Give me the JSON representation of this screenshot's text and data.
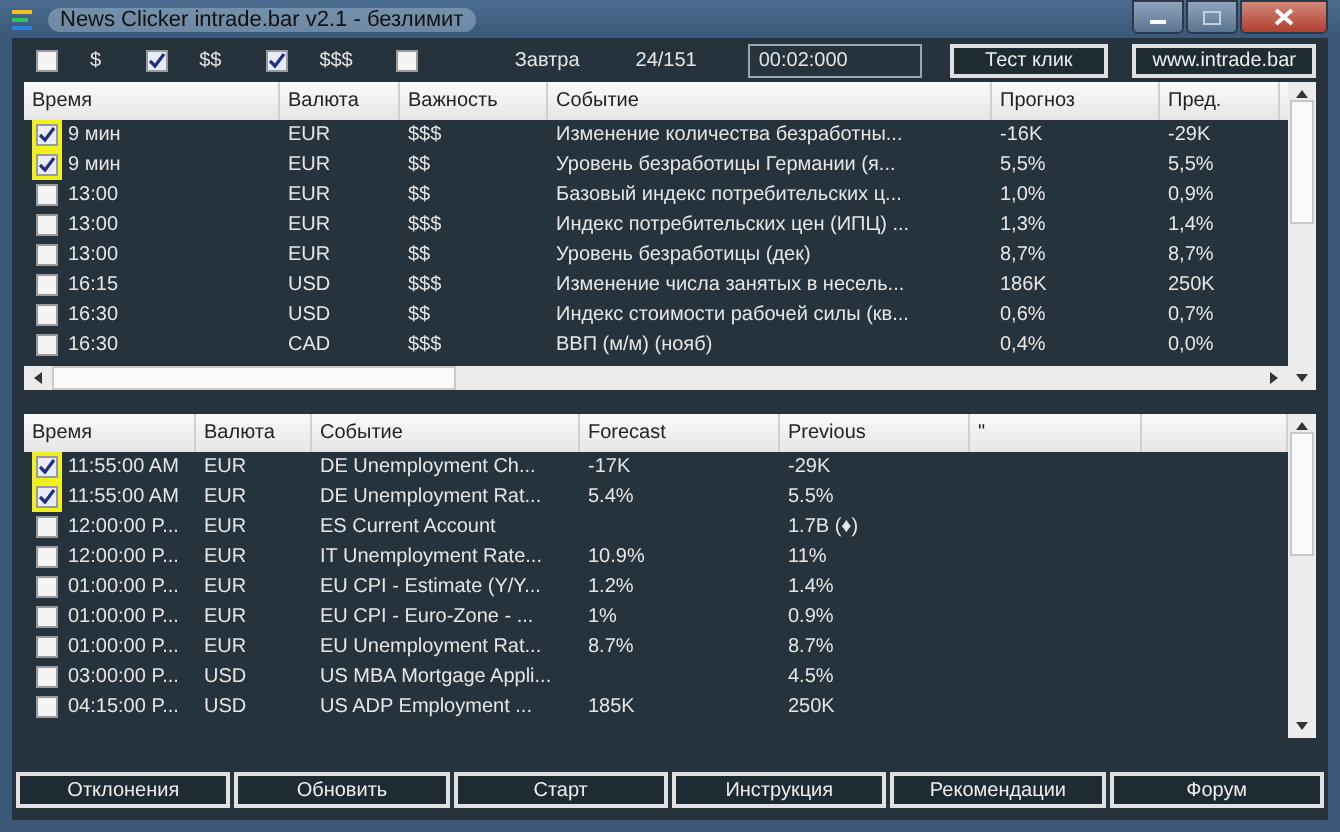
{
  "window": {
    "title": "News Clicker intrade.bar v2.1  - безлимит"
  },
  "toolbar": {
    "filters": [
      {
        "kind": "checkbox",
        "checked": false
      },
      {
        "kind": "label",
        "text": "$"
      },
      {
        "kind": "checkbox",
        "checked": true
      },
      {
        "kind": "label",
        "text": "$$"
      },
      {
        "kind": "checkbox",
        "checked": true
      },
      {
        "kind": "label",
        "text": "$$$"
      },
      {
        "kind": "checkbox",
        "checked": false
      }
    ],
    "tomorrow": "Завтра",
    "count": "24/151",
    "timer": "00:02:000",
    "buttons": [
      "Тест клик",
      "www.intrade.bar"
    ]
  },
  "top_table": {
    "columns": [
      "Время",
      "Валюта",
      "Важность",
      "Событие",
      "Прогноз",
      "Пред."
    ],
    "rows": [
      {
        "checked": true,
        "highlighted": true,
        "cells": [
          "9 мин",
          "EUR",
          "$$$",
          "Изменение количества безработны...",
          "-16K",
          "-29K"
        ]
      },
      {
        "checked": true,
        "highlighted": true,
        "cells": [
          "9 мин",
          "EUR",
          "$$",
          "Уровень безработицы Германии  (я...",
          "5,5%",
          "5,5%"
        ]
      },
      {
        "checked": false,
        "highlighted": false,
        "cells": [
          "13:00",
          "EUR",
          "$$",
          "Базовый индекс потребительских ц...",
          "1,0%",
          "0,9%"
        ]
      },
      {
        "checked": false,
        "highlighted": false,
        "cells": [
          "13:00",
          "EUR",
          "$$$",
          "Индекс потребительских цен (ИПЦ) ...",
          "1,3%",
          "1,4%"
        ]
      },
      {
        "checked": false,
        "highlighted": false,
        "cells": [
          "13:00",
          "EUR",
          "$$",
          "Уровень безработицы  (дек)",
          "8,7%",
          "8,7%"
        ]
      },
      {
        "checked": false,
        "highlighted": false,
        "cells": [
          "16:15",
          "USD",
          "$$$",
          "Изменение числа занятых в несель...",
          "186K",
          "250K"
        ]
      },
      {
        "checked": false,
        "highlighted": false,
        "cells": [
          "16:30",
          "USD",
          "$$",
          "Индекс стоимости рабочей силы (кв...",
          "0,6%",
          "0,7%"
        ]
      },
      {
        "checked": false,
        "highlighted": false,
        "cells": [
          "16:30",
          "CAD",
          "$$$",
          "ВВП (м/м)  (нояб)",
          "0,4%",
          "0,0%"
        ]
      }
    ]
  },
  "bottom_table": {
    "columns": [
      "Время",
      "Валюта",
      "Событие",
      "Forecast",
      "Previous",
      "\""
    ],
    "rows": [
      {
        "checked": true,
        "highlighted": true,
        "cells": [
          "11:55:00 AM",
          "EUR",
          "DE Unemployment Ch...",
          "-17K",
          "-29K"
        ]
      },
      {
        "checked": true,
        "highlighted": true,
        "cells": [
          "11:55:00 AM",
          "EUR",
          "DE Unemployment Rat...",
          "5.4%",
          "5.5%"
        ]
      },
      {
        "checked": false,
        "highlighted": false,
        "cells": [
          "12:00:00 P...",
          "EUR",
          "ES Current Account",
          "",
          "1.7B (♦)"
        ]
      },
      {
        "checked": false,
        "highlighted": false,
        "cells": [
          "12:00:00 P...",
          "EUR",
          "IT Unemployment Rate...",
          "10.9%",
          "11%"
        ]
      },
      {
        "checked": false,
        "highlighted": false,
        "cells": [
          "01:00:00 P...",
          "EUR",
          "EU CPI - Estimate (Y/Y...",
          "1.2%",
          "1.4%"
        ]
      },
      {
        "checked": false,
        "highlighted": false,
        "cells": [
          "01:00:00 P...",
          "EUR",
          "EU CPI - Euro-Zone - ...",
          "1%",
          "0.9%"
        ]
      },
      {
        "checked": false,
        "highlighted": false,
        "cells": [
          "01:00:00 P...",
          "EUR",
          "EU Unemployment Rat...",
          "8.7%",
          "8.7%"
        ]
      },
      {
        "checked": false,
        "highlighted": false,
        "cells": [
          "03:00:00 P...",
          "USD",
          "US MBA Mortgage Appli...",
          "",
          "4.5%"
        ]
      },
      {
        "checked": false,
        "highlighted": false,
        "cells": [
          "04:15:00 P...",
          "USD",
          "US ADP Employment ...",
          "185K",
          "250K"
        ]
      }
    ]
  },
  "bottom_buttons": [
    "Отклонения",
    "Обновить",
    "Старт",
    "Инструкция",
    "Рекомендации",
    "Форум"
  ]
}
